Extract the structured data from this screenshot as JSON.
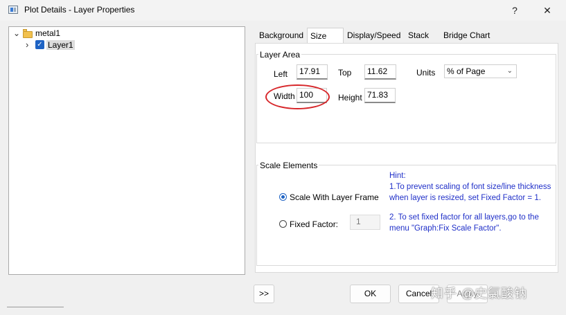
{
  "window": {
    "title": "Plot Details - Layer Properties",
    "help_label": "?",
    "close_label": "✕"
  },
  "tree": {
    "root_label": "metal1",
    "child_label": "Layer1",
    "root_toggle": "⌄",
    "child_toggle": "›",
    "check_mark": "✓"
  },
  "tabs": [
    {
      "label": "Background"
    },
    {
      "label": "Size"
    },
    {
      "label": "Display/Speed"
    },
    {
      "label": "Stack"
    },
    {
      "label": "Bridge Chart"
    }
  ],
  "layer_area": {
    "group_label": "Layer Area",
    "left_label": "Left",
    "left_value": "17.91",
    "top_label": "Top",
    "top_value": "11.62",
    "units_label": "Units",
    "units_value": "% of Page",
    "width_label": "Width",
    "width_value": "100",
    "height_label": "Height",
    "height_value": "71.83"
  },
  "scale_elements": {
    "group_label": "Scale Elements",
    "option_layer_frame": "Scale With Layer Frame",
    "option_fixed": "Fixed Factor:",
    "fixed_value": "1",
    "selected": "Scale With Layer Frame"
  },
  "hint": {
    "title": "Hint:",
    "line1": "1.To prevent scaling of font size/line thickness when layer is resized, set Fixed Factor = 1.",
    "line2": "2. To set fixed factor for all layers,go to the menu \"Graph:Fix Scale Factor\"."
  },
  "buttons": {
    "expand": ">>",
    "ok": "OK",
    "cancel": "Cancel",
    "apply": "Apply"
  },
  "watermark": "知乎 @史氯酸钠",
  "colors": {
    "hint_text": "#1f2fc8",
    "accent": "#1e63c4",
    "annotation_ring": "#d7262a"
  }
}
